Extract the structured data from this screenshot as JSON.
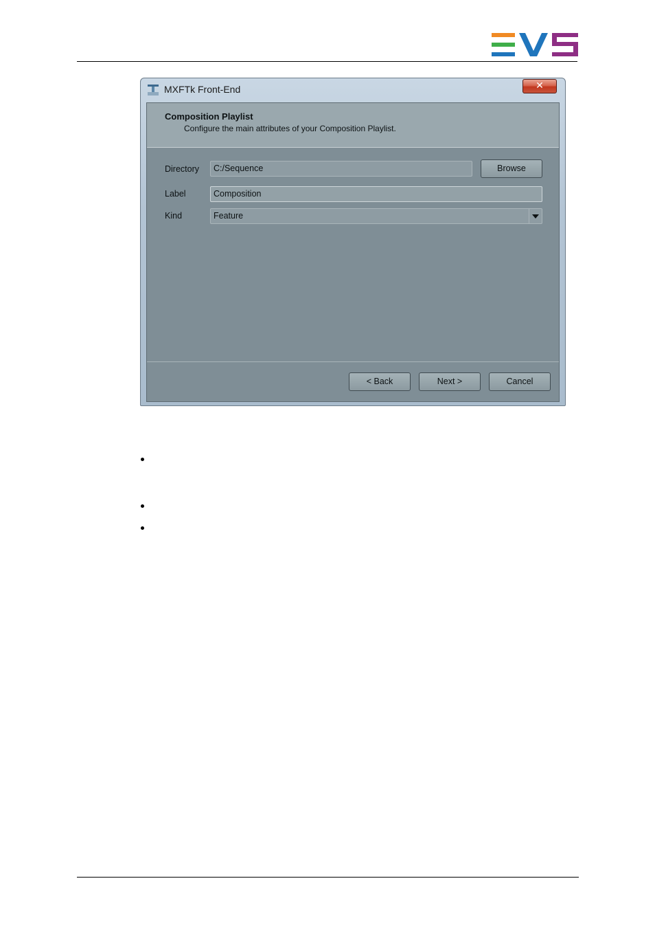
{
  "colors": {
    "logo_orange": "#f08a24",
    "logo_green": "#3fae49",
    "logo_blue": "#1f75bc",
    "logo_purple": "#8e2e84"
  },
  "window": {
    "title": "MXFTk Front-End",
    "close_glyph": "✕"
  },
  "header": {
    "title": "Composition Playlist",
    "subtitle": "Configure the main attributes of your Composition Playlist."
  },
  "form": {
    "directory_label": "Directory",
    "directory_value": "C:/Sequence",
    "browse_label": "Browse",
    "label_label": "Label",
    "label_value": "Composition",
    "kind_label": "Kind",
    "kind_value": "Feature"
  },
  "footer": {
    "back_label": "< Back",
    "next_label": "Next >",
    "cancel_label": "Cancel"
  }
}
